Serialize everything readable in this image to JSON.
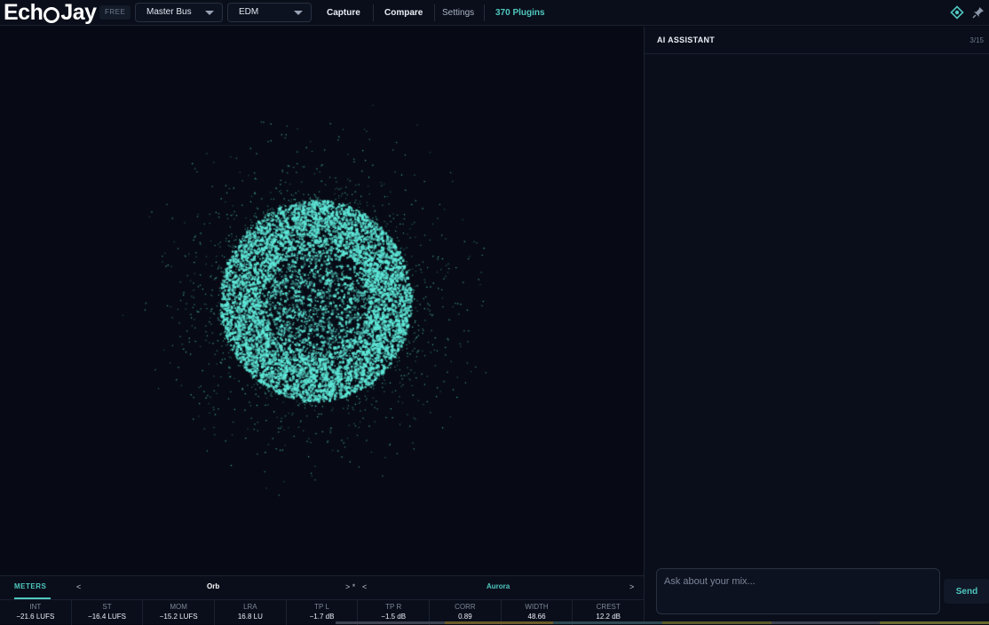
{
  "app": {
    "logo": {
      "pre": "Ech",
      "post": "Jay"
    },
    "badge": "FREE"
  },
  "toolbar": {
    "bus_select": "Master Bus",
    "genre_select": "EDM",
    "capture_label": "Capture",
    "compare_label": "Compare",
    "settings_label": "Settings",
    "plugins_label": "370 Plugins"
  },
  "colors": {
    "accent": "#4fc7bf",
    "particle": "#5ee8d8",
    "background": "#070a14"
  },
  "icons": {
    "target": "target-diamond-icon",
    "pin": "pin-icon"
  },
  "visualizer": {
    "mode": "Orb",
    "palette": "Aurora"
  },
  "meters": {
    "tab_label": "METERS",
    "nav": {
      "prev_mode": "<",
      "next_mode": "> *",
      "prev_palette": "<",
      "next_palette": ">"
    },
    "cells": [
      {
        "label": "INT",
        "value": "−21.6 LUFS"
      },
      {
        "label": "ST",
        "value": "−16.4 LUFS"
      },
      {
        "label": "MOM",
        "value": "−15.2 LUFS"
      },
      {
        "label": "LRA",
        "value": "16.8 LU"
      },
      {
        "label": "TP L",
        "value": "−1.7 dB"
      },
      {
        "label": "TP R",
        "value": "−1.5 dB"
      },
      {
        "label": "CORR",
        "value": "0.89"
      },
      {
        "label": "WIDTH",
        "value": "48.66"
      },
      {
        "label": "CREST",
        "value": "12.2 dB"
      }
    ]
  },
  "assistant": {
    "title": "AI ASSISTANT",
    "count": "3/15",
    "input_placeholder": "Ask about your mix...",
    "send_label": "Send"
  }
}
